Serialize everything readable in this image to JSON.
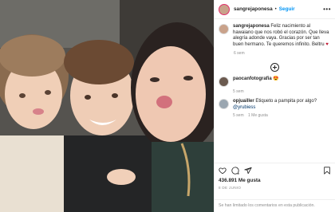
{
  "post": {
    "username": "sangrejaponesa",
    "separator": "•",
    "follow_label": "Seguir",
    "more_icon": "more-horizontal-icon",
    "caption": {
      "username": "sangrejaponesa",
      "text": "Feliz nacimiento al hawaiano que nos robó el corazón. Que lleva alegría adonde vaya. Gracias por ser tan buen hermano. Te queremos infinito. Beltru",
      "emoji": "♥"
    },
    "caption_age": "6 sem",
    "load_more_icon": "plus-circle-icon",
    "comments": [
      {
        "username": "paocanfotografia",
        "text": "",
        "emoji": "😍",
        "age": "5 sem",
        "extra": ""
      },
      {
        "username": "opjuailler",
        "text": "Etiqueto a pampita por algo?",
        "mention": "@yrubiess",
        "age": "5 sem",
        "extra": "1 Me gusta"
      }
    ],
    "actions": {
      "like_icon": "heart-icon",
      "comment_icon": "comment-icon",
      "share_icon": "paper-plane-icon",
      "save_icon": "bookmark-icon"
    },
    "likes": "436.891 Me gusta",
    "date": "8 DE JUNIO",
    "comments_limited": "Se han limitado los comentarios en esta publicación."
  }
}
